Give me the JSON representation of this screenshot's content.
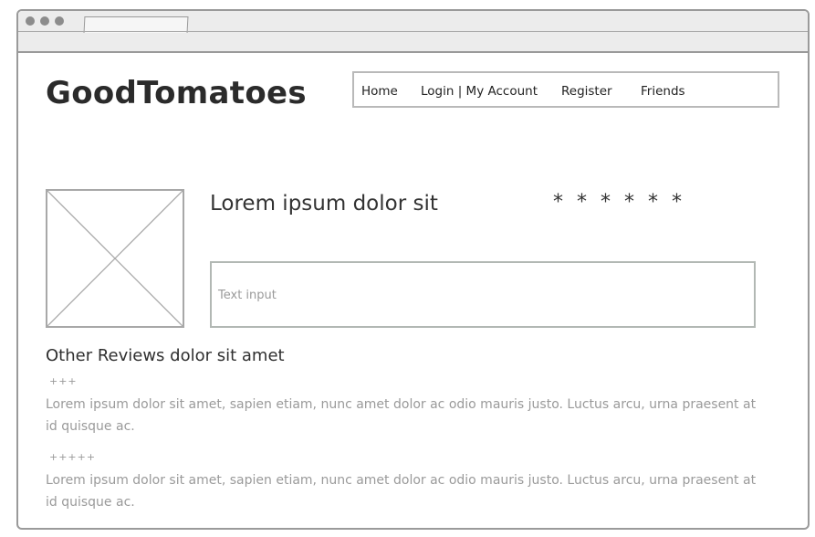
{
  "logo": "GoodTomatoes",
  "nav": {
    "items": [
      {
        "label": "Home"
      },
      {
        "label": "Login | My Account"
      },
      {
        "label": "Register"
      },
      {
        "label": "Friends"
      }
    ]
  },
  "movie": {
    "title": "Lorem ipsum dolor sit",
    "rating": "* * * * * *",
    "image": "image-placeholder"
  },
  "review_input": {
    "placeholder": "Text input"
  },
  "other_reviews": {
    "heading": "Other Reviews dolor sit amet",
    "items": [
      {
        "rating": "+++",
        "text": "Lorem ipsum dolor sit amet, sapien etiam, nunc amet dolor ac odio mauris justo. Luctus arcu, urna praesent at id quisque ac."
      },
      {
        "rating": "+++++",
        "text": "Lorem ipsum dolor sit amet, sapien etiam, nunc amet dolor ac odio mauris justo. Luctus arcu, urna praesent at id quisque ac."
      }
    ]
  },
  "colors": {
    "frame": "#9a9a9a",
    "muted_text": "#9a9a9a",
    "input_border": "#b2b8b4"
  }
}
